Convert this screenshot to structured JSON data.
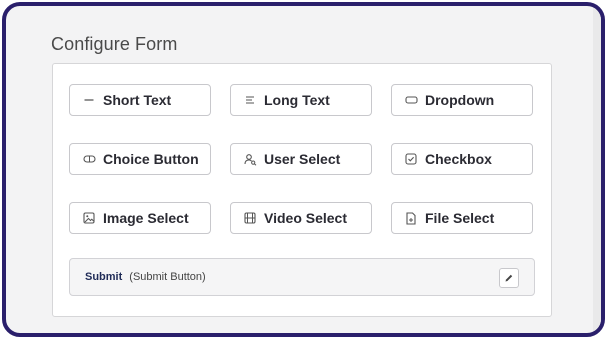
{
  "title": "Configure Form",
  "fields": [
    {
      "label": "Short Text",
      "icon": "minus-icon"
    },
    {
      "label": "Long Text",
      "icon": "lines-icon"
    },
    {
      "label": "Dropdown",
      "icon": "dropdown-icon"
    },
    {
      "label": "Choice Button",
      "icon": "toggle-pill-icon"
    },
    {
      "label": "User Select",
      "icon": "user-search-icon"
    },
    {
      "label": "Checkbox",
      "icon": "checkbox-icon"
    },
    {
      "label": "Image Select",
      "icon": "image-icon"
    },
    {
      "label": "Video Select",
      "icon": "film-icon"
    },
    {
      "label": "File Select",
      "icon": "file-plus-icon"
    }
  ],
  "submit": {
    "name": "Submit",
    "type": "(Submit Button)",
    "edit_icon": "pencil-icon"
  },
  "colors": {
    "frame_border": "#2a1f6b",
    "submit_name": "#1f2b57"
  }
}
